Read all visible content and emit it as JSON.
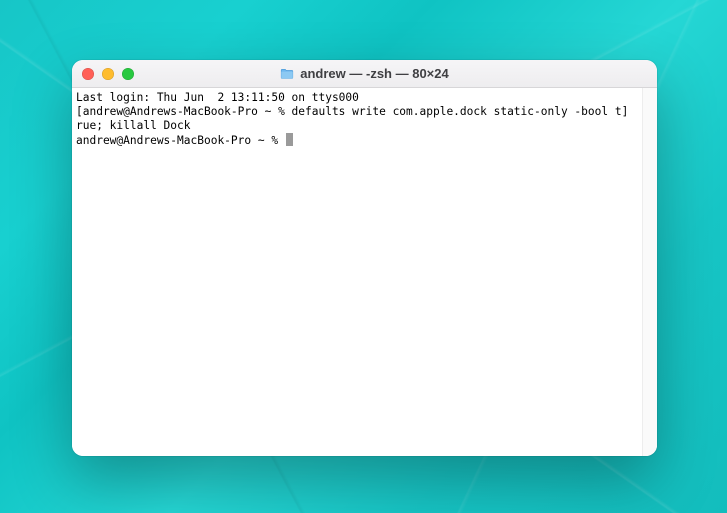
{
  "window": {
    "title": "andrew — -zsh — 80×24"
  },
  "terminal": {
    "lines": {
      "l0": "Last login: Thu Jun  2 13:11:50 on ttys000",
      "l1": "[andrew@Andrews-MacBook-Pro ~ % defaults write com.apple.dock static-only -bool t]",
      "l2": "rue; killall Dock",
      "l3": "andrew@Andrews-MacBook-Pro ~ % "
    }
  }
}
